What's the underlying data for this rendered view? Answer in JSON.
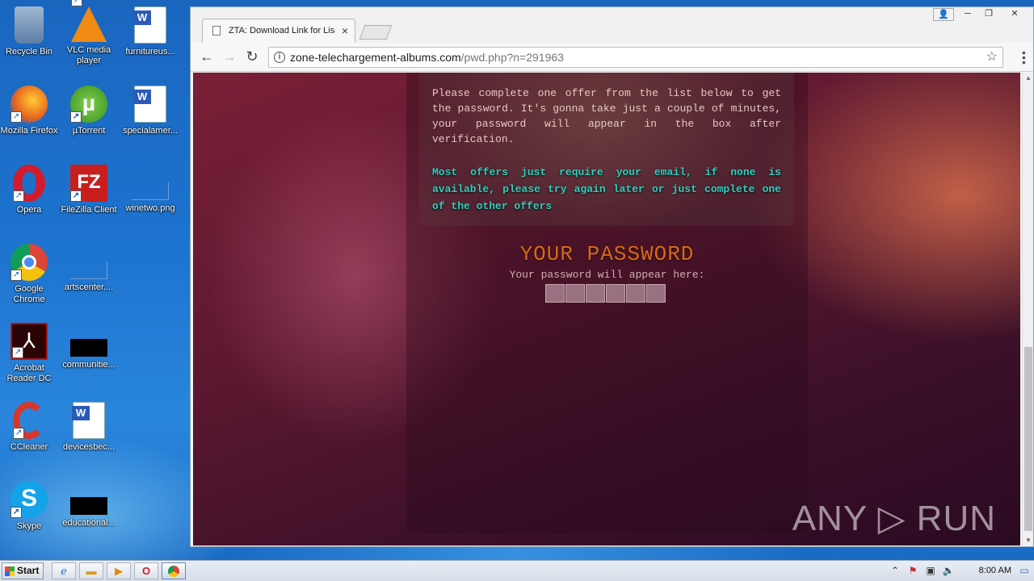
{
  "desktop": {
    "icons": [
      {
        "label": "Recycle Bin",
        "icon": "recycle-bin-icon",
        "color": "#6c8fb8"
      },
      {
        "label": "VLC media player",
        "icon": "vlc-icon",
        "color": "#f08a12"
      },
      {
        "label": "furnitureus...",
        "icon": "word-doc-icon",
        "color": "#2b5bb8"
      },
      {
        "label": "Mozilla Firefox",
        "icon": "firefox-icon",
        "color": "#e8671e"
      },
      {
        "label": "µTorrent",
        "icon": "utorrent-icon",
        "color": "#58b030"
      },
      {
        "label": "specialamer...",
        "icon": "word-doc-icon",
        "color": "#2b5bb8"
      },
      {
        "label": "Opera",
        "icon": "opera-icon",
        "color": "#d21b2c"
      },
      {
        "label": "FileZilla Client",
        "icon": "filezilla-icon",
        "color": "#c81e1e"
      },
      {
        "label": "winetwo.png",
        "icon": "image-file-icon",
        "color": "#1d74cf"
      },
      {
        "label": "Google Chrome",
        "icon": "chrome-icon",
        "color": "#4a8af4"
      },
      {
        "label": "artscenter....",
        "icon": "file-icon",
        "color": "#1d74cf"
      },
      {
        "label": "Acrobat Reader DC",
        "icon": "acrobat-icon",
        "color": "#b31515"
      },
      {
        "label": "communitie...",
        "icon": "black-file-icon",
        "color": "#000000"
      },
      {
        "label": "CCleaner",
        "icon": "ccleaner-icon",
        "color": "#d9352a"
      },
      {
        "label": "devicesbec...",
        "icon": "word-doc-icon",
        "color": "#2b5bb8"
      },
      {
        "label": "Skype",
        "icon": "skype-icon",
        "color": "#13a3e8"
      },
      {
        "label": "educational...",
        "icon": "black-file-icon",
        "color": "#000000"
      }
    ]
  },
  "browser": {
    "tab_title": "ZTA: Download Link for Lisa",
    "url_host": "zone-telechargement-albums.com",
    "url_path": "/pwd.php?n=291963"
  },
  "page": {
    "offer_text": "Please complete one offer from the list below to get the password. It's gonna take just a couple of minutes, your password will appear in the box after verification.",
    "offer_note": "Most offers just require your email, if none is available, please try again later or just complete one of the other offers",
    "password_title": "YOUR PASSWORD",
    "password_subtitle": "Your password will appear here:",
    "password_box_count": 6,
    "watermark": "ANY ▷ RUN"
  },
  "taskbar": {
    "start_label": "Start",
    "clock": "8:00 AM"
  }
}
